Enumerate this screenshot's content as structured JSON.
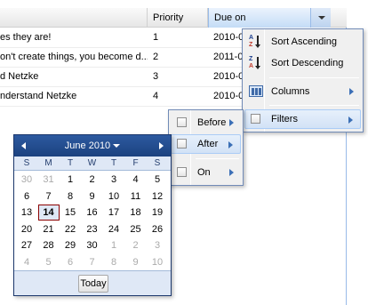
{
  "grid": {
    "columns": [
      "",
      "Priority",
      "Due on"
    ],
    "rows": [
      {
        "text": "es they are!",
        "priority": "1",
        "due": "2010-0"
      },
      {
        "text": "on't create things, you become d...",
        "priority": "2",
        "due": "2011-0"
      },
      {
        "text": "d Netzke",
        "priority": "3",
        "due": "2010-0"
      },
      {
        "text": "nderstand Netzke",
        "priority": "4",
        "due": "2010-0"
      }
    ]
  },
  "column_menu": {
    "sort_asc": "Sort Ascending",
    "sort_desc": "Sort Descending",
    "columns": "Columns",
    "filters": "Filters"
  },
  "date_filter_menu": {
    "before": "Before",
    "after": "After",
    "on": "On"
  },
  "datepicker": {
    "month_label": "June 2010",
    "day_headers": [
      "S",
      "M",
      "T",
      "W",
      "T",
      "F",
      "S"
    ],
    "weeks": [
      [
        {
          "d": "30",
          "o": true
        },
        {
          "d": "31",
          "o": true
        },
        {
          "d": "1"
        },
        {
          "d": "2"
        },
        {
          "d": "3"
        },
        {
          "d": "4"
        },
        {
          "d": "5"
        }
      ],
      [
        {
          "d": "6"
        },
        {
          "d": "7"
        },
        {
          "d": "8"
        },
        {
          "d": "9"
        },
        {
          "d": "10"
        },
        {
          "d": "11"
        },
        {
          "d": "12"
        }
      ],
      [
        {
          "d": "13"
        },
        {
          "d": "14",
          "t": true
        },
        {
          "d": "15"
        },
        {
          "d": "16"
        },
        {
          "d": "17"
        },
        {
          "d": "18"
        },
        {
          "d": "19"
        }
      ],
      [
        {
          "d": "20"
        },
        {
          "d": "21"
        },
        {
          "d": "22"
        },
        {
          "d": "23"
        },
        {
          "d": "24"
        },
        {
          "d": "25"
        },
        {
          "d": "26"
        }
      ],
      [
        {
          "d": "27"
        },
        {
          "d": "28"
        },
        {
          "d": "29"
        },
        {
          "d": "30"
        },
        {
          "d": "1",
          "o": true
        },
        {
          "d": "2",
          "o": true
        },
        {
          "d": "3",
          "o": true
        }
      ],
      [
        {
          "d": "4",
          "o": true
        },
        {
          "d": "5",
          "o": true
        },
        {
          "d": "6",
          "o": true
        },
        {
          "d": "7",
          "o": true
        },
        {
          "d": "8",
          "o": true
        },
        {
          "d": "9",
          "o": true
        },
        {
          "d": "10",
          "o": true
        }
      ]
    ],
    "today_button": "Today"
  }
}
